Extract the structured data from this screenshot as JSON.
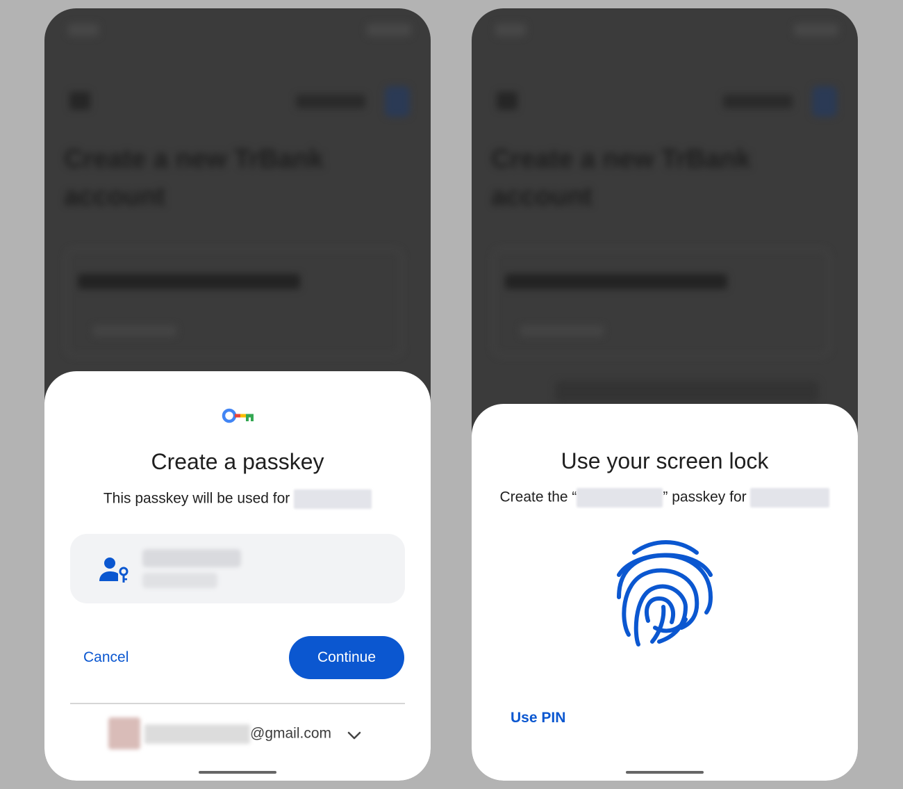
{
  "left_screen": {
    "background_app": {
      "heading": "Create a new TrBank account"
    },
    "sheet": {
      "icon": "passkey-key-icon",
      "title": "Create a passkey",
      "subtitle": "This passkey will be used for",
      "account_icon": "person-key-icon",
      "cancel_label": "Cancel",
      "continue_label": "Continue",
      "email_suffix": "@gmail.com",
      "chevron": "chevron-down-icon"
    }
  },
  "right_screen": {
    "background_app": {
      "heading": "Create a new TrBank account"
    },
    "sheet": {
      "title": "Use your screen lock",
      "subtitle_prefix": "Create the “",
      "subtitle_middle": "” passkey for",
      "icon": "fingerprint-icon",
      "use_pin_label": "Use PIN"
    }
  },
  "colors": {
    "accent": "#0b57d0",
    "page_background": "#b3b3b3",
    "sheet_background": "#ffffff",
    "card_background": "#f2f3f5"
  }
}
